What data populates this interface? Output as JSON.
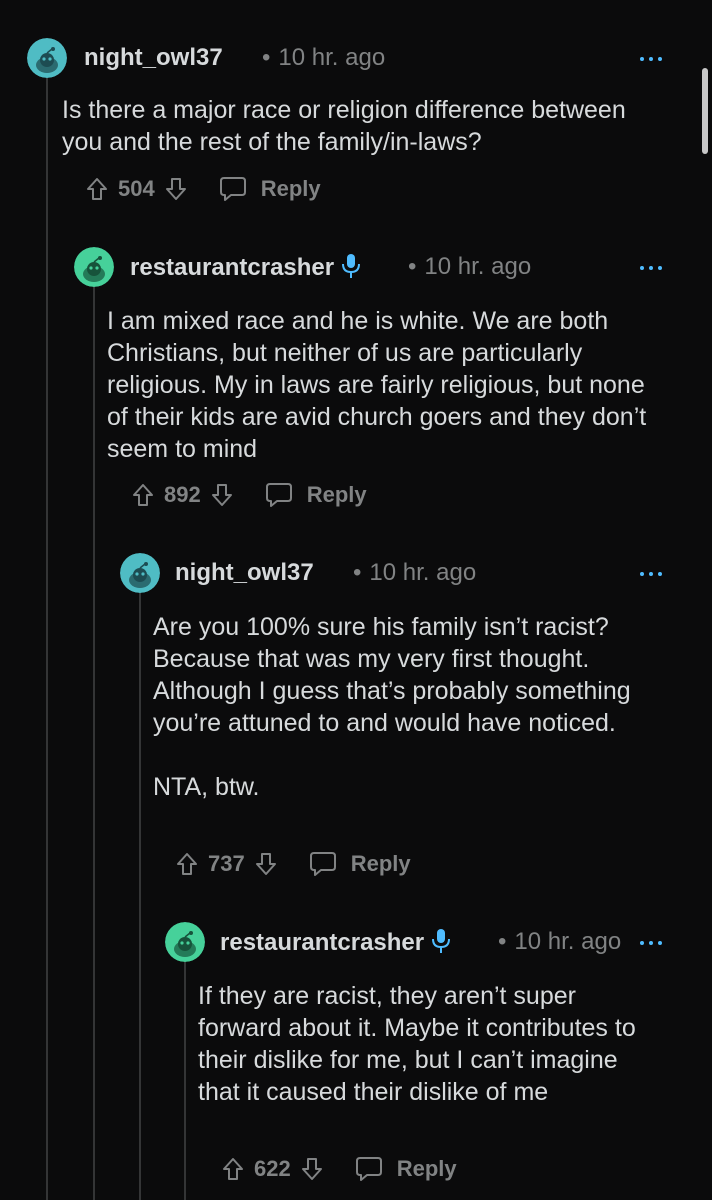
{
  "comments": [
    {
      "username": "night_owl37",
      "has_mic": false,
      "time": "10 hr. ago",
      "body": [
        "Is there a major race or religion difference between you and the rest of the family/in-laws?"
      ],
      "score": "504",
      "reply_label": "Reply"
    },
    {
      "username": "restaurantcrasher",
      "has_mic": true,
      "time": "10 hr. ago",
      "body": [
        "I am mixed race and he is white. We are both Christians, but neither of us are particularly religious. My in laws are fairly religious, but none of their kids are avid church goers and they don’t seem to mind"
      ],
      "score": "892",
      "reply_label": "Reply"
    },
    {
      "username": "night_owl37",
      "has_mic": false,
      "time": "10 hr. ago",
      "body": [
        "Are you 100% sure his family isn’t racist? Because that was my very first thought. Although I guess that’s probably something you’re attuned to and would have noticed.",
        "NTA, btw."
      ],
      "score": "737",
      "reply_label": "Reply"
    },
    {
      "username": "restaurantcrasher",
      "has_mic": true,
      "time": "10 hr. ago",
      "body": [
        "If they are racist, they aren’t super forward about it. Maybe it contributes to their dislike for me, but I can’t imagine that it caused their dislike of me"
      ],
      "score": "622",
      "reply_label": "Reply"
    }
  ],
  "colors": {
    "background": "#0b0b0c",
    "text": "#d7dadc",
    "muted": "#818384",
    "accent": "#4fbcff",
    "avatar_owl": "#4fbcc4",
    "avatar_crasher": "#46d19a"
  },
  "icons": [
    "snoo-avatar-icon",
    "mic-icon",
    "more-options-icon",
    "upvote-icon",
    "downvote-icon",
    "reply-icon"
  ]
}
